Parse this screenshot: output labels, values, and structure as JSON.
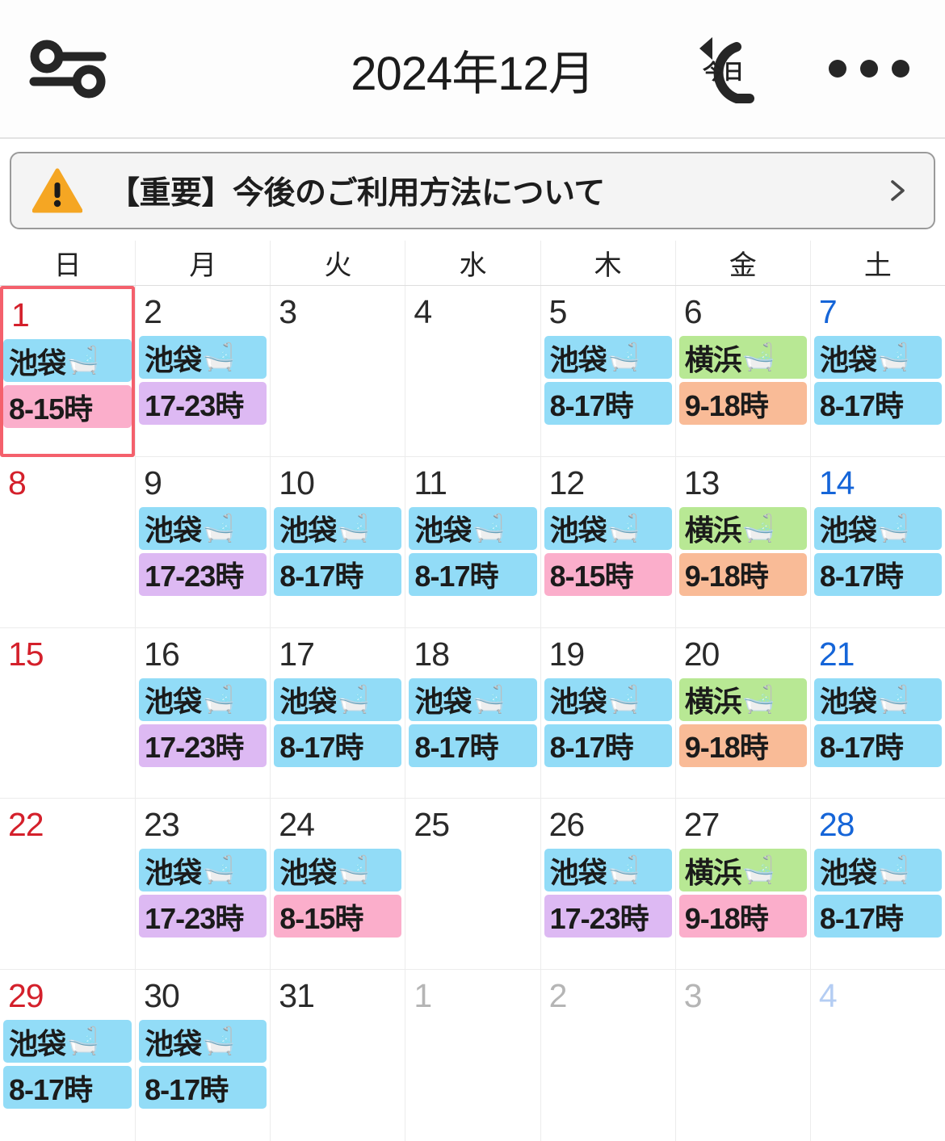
{
  "topbar": {
    "filter_icon": "filter-sliders-icon",
    "title": "2024年12月",
    "today_label": "今日",
    "more_icon": "more-options-icon"
  },
  "banner": {
    "warning_icon": "warning-triangle-icon",
    "text": "【重要】今後のご利用方法について",
    "chevron_icon": "chevron-right-icon",
    "warning_color": "#f5a623",
    "border_color": "#9a9a9a",
    "background_color": "#f4f4f4"
  },
  "weekdays": [
    "日",
    "月",
    "火",
    "水",
    "木",
    "金",
    "土"
  ],
  "colors": {
    "sunday": "#d4202b",
    "saturday": "#1565d8",
    "weekday": "#2a2a2a",
    "other_month": "#b5b5b5",
    "selected_border": "#f4606c",
    "chip_blue": "#92dcf7",
    "chip_green": "#b8e894",
    "chip_pink": "#fbaecb",
    "chip_purple": "#ddb9f3",
    "chip_orange": "#f9bb97"
  },
  "bath_emoji": "🛁",
  "calendar": {
    "weeks": [
      [
        {
          "day": "1",
          "month": "current",
          "selected": true,
          "chips": [
            {
              "label": "池袋",
              "emoji": true,
              "color": "blue"
            },
            {
              "label": "8-15時",
              "emoji": false,
              "color": "pink"
            }
          ]
        },
        {
          "day": "2",
          "month": "current",
          "selected": false,
          "chips": [
            {
              "label": "池袋",
              "emoji": true,
              "color": "blue"
            },
            {
              "label": "17-23時",
              "emoji": false,
              "color": "purple"
            }
          ]
        },
        {
          "day": "3",
          "month": "current",
          "selected": false,
          "chips": []
        },
        {
          "day": "4",
          "month": "current",
          "selected": false,
          "chips": []
        },
        {
          "day": "5",
          "month": "current",
          "selected": false,
          "chips": [
            {
              "label": "池袋",
              "emoji": true,
              "color": "blue"
            },
            {
              "label": "8-17時",
              "emoji": false,
              "color": "blue"
            }
          ]
        },
        {
          "day": "6",
          "month": "current",
          "selected": false,
          "chips": [
            {
              "label": "横浜",
              "emoji": true,
              "color": "green"
            },
            {
              "label": "9-18時",
              "emoji": false,
              "color": "orange"
            }
          ]
        },
        {
          "day": "7",
          "month": "current",
          "selected": false,
          "chips": [
            {
              "label": "池袋",
              "emoji": true,
              "color": "blue"
            },
            {
              "label": "8-17時",
              "emoji": false,
              "color": "blue"
            }
          ]
        }
      ],
      [
        {
          "day": "8",
          "month": "current",
          "selected": false,
          "chips": []
        },
        {
          "day": "9",
          "month": "current",
          "selected": false,
          "chips": [
            {
              "label": "池袋",
              "emoji": true,
              "color": "blue"
            },
            {
              "label": "17-23時",
              "emoji": false,
              "color": "purple"
            }
          ]
        },
        {
          "day": "10",
          "month": "current",
          "selected": false,
          "chips": [
            {
              "label": "池袋",
              "emoji": true,
              "color": "blue"
            },
            {
              "label": "8-17時",
              "emoji": false,
              "color": "blue"
            }
          ]
        },
        {
          "day": "11",
          "month": "current",
          "selected": false,
          "chips": [
            {
              "label": "池袋",
              "emoji": true,
              "color": "blue"
            },
            {
              "label": "8-17時",
              "emoji": false,
              "color": "blue"
            }
          ]
        },
        {
          "day": "12",
          "month": "current",
          "selected": false,
          "chips": [
            {
              "label": "池袋",
              "emoji": true,
              "color": "blue"
            },
            {
              "label": "8-15時",
              "emoji": false,
              "color": "pink"
            }
          ]
        },
        {
          "day": "13",
          "month": "current",
          "selected": false,
          "chips": [
            {
              "label": "横浜",
              "emoji": true,
              "color": "green"
            },
            {
              "label": "9-18時",
              "emoji": false,
              "color": "orange"
            }
          ]
        },
        {
          "day": "14",
          "month": "current",
          "selected": false,
          "chips": [
            {
              "label": "池袋",
              "emoji": true,
              "color": "blue"
            },
            {
              "label": "8-17時",
              "emoji": false,
              "color": "blue"
            }
          ]
        }
      ],
      [
        {
          "day": "15",
          "month": "current",
          "selected": false,
          "chips": []
        },
        {
          "day": "16",
          "month": "current",
          "selected": false,
          "chips": [
            {
              "label": "池袋",
              "emoji": true,
              "color": "blue"
            },
            {
              "label": "17-23時",
              "emoji": false,
              "color": "purple"
            }
          ]
        },
        {
          "day": "17",
          "month": "current",
          "selected": false,
          "chips": [
            {
              "label": "池袋",
              "emoji": true,
              "color": "blue"
            },
            {
              "label": "8-17時",
              "emoji": false,
              "color": "blue"
            }
          ]
        },
        {
          "day": "18",
          "month": "current",
          "selected": false,
          "chips": [
            {
              "label": "池袋",
              "emoji": true,
              "color": "blue"
            },
            {
              "label": "8-17時",
              "emoji": false,
              "color": "blue"
            }
          ]
        },
        {
          "day": "19",
          "month": "current",
          "selected": false,
          "chips": [
            {
              "label": "池袋",
              "emoji": true,
              "color": "blue"
            },
            {
              "label": "8-17時",
              "emoji": false,
              "color": "blue"
            }
          ]
        },
        {
          "day": "20",
          "month": "current",
          "selected": false,
          "chips": [
            {
              "label": "横浜",
              "emoji": true,
              "color": "green"
            },
            {
              "label": "9-18時",
              "emoji": false,
              "color": "orange"
            }
          ]
        },
        {
          "day": "21",
          "month": "current",
          "selected": false,
          "chips": [
            {
              "label": "池袋",
              "emoji": true,
              "color": "blue"
            },
            {
              "label": "8-17時",
              "emoji": false,
              "color": "blue"
            }
          ]
        }
      ],
      [
        {
          "day": "22",
          "month": "current",
          "selected": false,
          "chips": []
        },
        {
          "day": "23",
          "month": "current",
          "selected": false,
          "chips": [
            {
              "label": "池袋",
              "emoji": true,
              "color": "blue"
            },
            {
              "label": "17-23時",
              "emoji": false,
              "color": "purple"
            }
          ]
        },
        {
          "day": "24",
          "month": "current",
          "selected": false,
          "chips": [
            {
              "label": "池袋",
              "emoji": true,
              "color": "blue"
            },
            {
              "label": "8-15時",
              "emoji": false,
              "color": "pink"
            }
          ]
        },
        {
          "day": "25",
          "month": "current",
          "selected": false,
          "chips": []
        },
        {
          "day": "26",
          "month": "current",
          "selected": false,
          "chips": [
            {
              "label": "池袋",
              "emoji": true,
              "color": "blue"
            },
            {
              "label": "17-23時",
              "emoji": false,
              "color": "purple"
            }
          ]
        },
        {
          "day": "27",
          "month": "current",
          "selected": false,
          "chips": [
            {
              "label": "横浜",
              "emoji": true,
              "color": "green"
            },
            {
              "label": "9-18時",
              "emoji": false,
              "color": "pink"
            }
          ]
        },
        {
          "day": "28",
          "month": "current",
          "selected": false,
          "chips": [
            {
              "label": "池袋",
              "emoji": true,
              "color": "blue"
            },
            {
              "label": "8-17時",
              "emoji": false,
              "color": "blue"
            }
          ]
        }
      ],
      [
        {
          "day": "29",
          "month": "current",
          "selected": false,
          "chips": [
            {
              "label": "池袋",
              "emoji": true,
              "color": "blue"
            },
            {
              "label": "8-17時",
              "emoji": false,
              "color": "blue"
            }
          ]
        },
        {
          "day": "30",
          "month": "current",
          "selected": false,
          "chips": [
            {
              "label": "池袋",
              "emoji": true,
              "color": "blue"
            },
            {
              "label": "8-17時",
              "emoji": false,
              "color": "blue"
            }
          ]
        },
        {
          "day": "31",
          "month": "current",
          "selected": false,
          "chips": []
        },
        {
          "day": "1",
          "month": "next",
          "selected": false,
          "chips": []
        },
        {
          "day": "2",
          "month": "next",
          "selected": false,
          "chips": []
        },
        {
          "day": "3",
          "month": "next",
          "selected": false,
          "chips": []
        },
        {
          "day": "4",
          "month": "next",
          "selected": false,
          "chips": []
        }
      ]
    ]
  }
}
